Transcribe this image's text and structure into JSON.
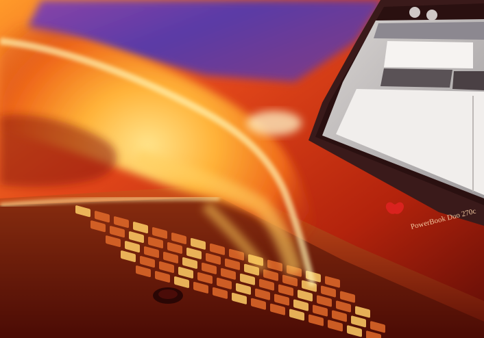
{
  "image": {
    "laptop_brand_text": "PowerBook Duo 270c",
    "colors": {
      "sky_purple": "#6a3fa0",
      "warm_orange": "#ff7a1a",
      "hot_yellow": "#ffd24a",
      "deep_red": "#8a1608",
      "screen_white": "#f4f1ef",
      "screen_grey": "#b9b6b8"
    }
  }
}
